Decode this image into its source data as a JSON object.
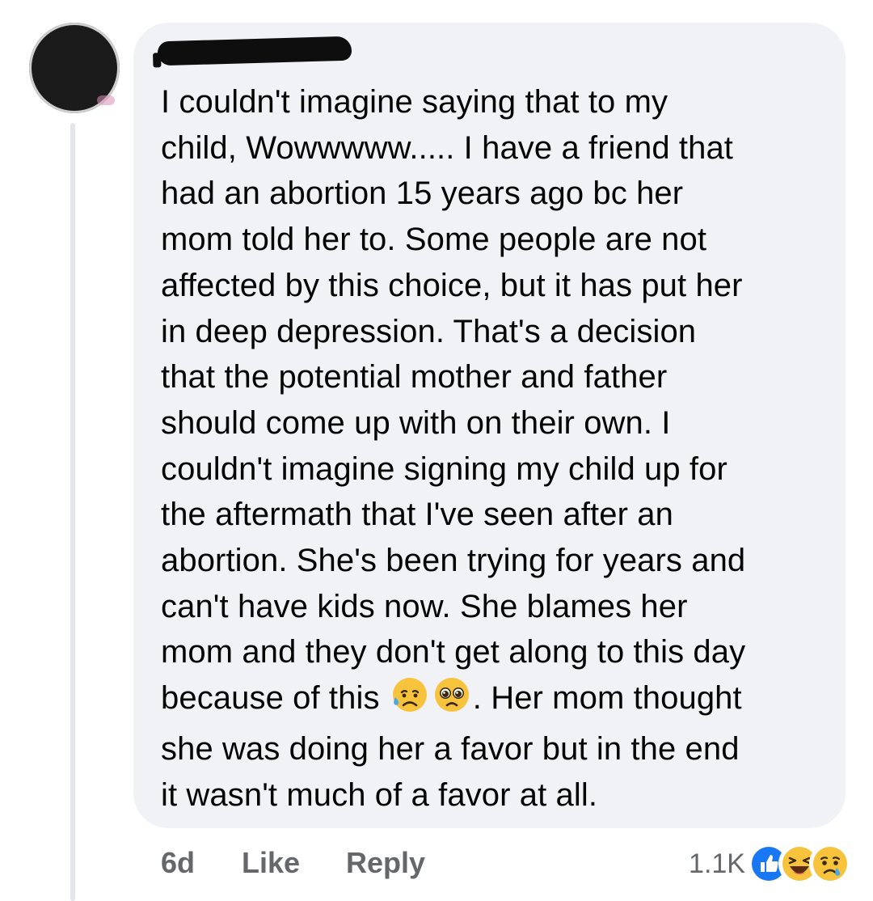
{
  "comment": {
    "paragraph_lines": [
      "I couldn't imagine saying that to my",
      "child, Wowwwww..... I have a friend that",
      "had an abortion 15 years ago bc her",
      "mom told her to. Some people are not",
      "affected by this choice, but it has put her",
      "in deep depression. That's a decision",
      "that the potential mother and father",
      "should come up with on their own. I",
      "couldn't imagine signing my child up for",
      "the aftermath that I've seen after an",
      "abortion. She's been trying for years and",
      "can't have kids now. She blames her",
      "mom and they don't get along to this day"
    ],
    "emoji_line_before": "because of this ",
    "emoji_line_after": ". Her mom thought",
    "tail_lines": [
      "she was doing her a favor but in the end",
      "it wasn't much of a favor at all."
    ],
    "inline_emojis": [
      "sad-but-relieved-face",
      "pleading-face"
    ]
  },
  "actions": {
    "time": "6d",
    "like_label": "Like",
    "reply_label": "Reply"
  },
  "reactions": {
    "count": "1.1K",
    "icons": [
      "like-reaction",
      "haha-reaction",
      "sad-reaction"
    ]
  },
  "colors": {
    "bubble_background": "#f0f2f5",
    "text": "#050505",
    "secondary_text": "#65676b",
    "like_blue": "#1877f2",
    "emoji_yellow": "#f7c23c"
  }
}
